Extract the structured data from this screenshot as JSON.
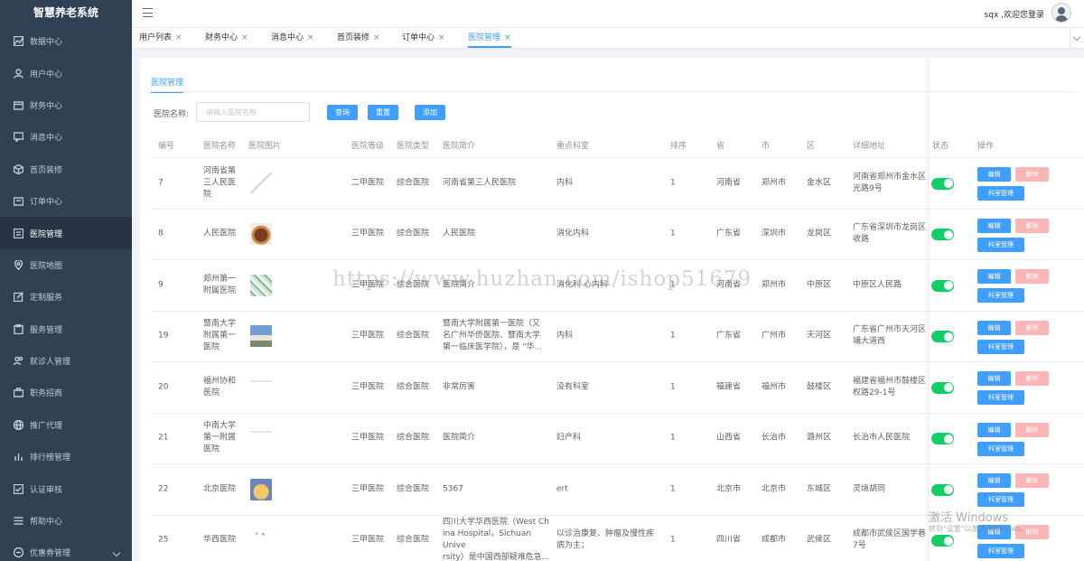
{
  "app": {
    "title": "智慧养老系统"
  },
  "sidebar": {
    "items": [
      {
        "label": "数据中心",
        "icon": "chart-icon"
      },
      {
        "label": "用户中心",
        "icon": "user-icon"
      },
      {
        "label": "财务中心",
        "icon": "wallet-icon"
      },
      {
        "label": "消息中心",
        "icon": "message-icon"
      },
      {
        "label": "首页装修",
        "icon": "cube-icon"
      },
      {
        "label": "订单中心",
        "icon": "cart-icon"
      },
      {
        "label": "医院管理",
        "icon": "list-icon",
        "active": true
      },
      {
        "label": "医院地图",
        "icon": "location-icon"
      },
      {
        "label": "定制服务",
        "icon": "edit-icon"
      },
      {
        "label": "服务管理",
        "icon": "clipboard-icon"
      },
      {
        "label": "就诊人管理",
        "icon": "users-icon"
      },
      {
        "label": "职务招商",
        "icon": "briefcase-icon"
      },
      {
        "label": "推广代理",
        "icon": "globe-icon"
      },
      {
        "label": "排行榜管理",
        "icon": "bars-icon"
      },
      {
        "label": "认证审核",
        "icon": "check-icon"
      },
      {
        "label": "帮助中心",
        "icon": "menu-icon"
      },
      {
        "label": "优惠券管理",
        "icon": "coupon-icon"
      }
    ]
  },
  "header": {
    "greeting": "sqx ,欢迎您登录"
  },
  "tabs": [
    {
      "label": "用户列表",
      "close": "×"
    },
    {
      "label": "财务中心",
      "close": "×"
    },
    {
      "label": "消息中心",
      "close": "×"
    },
    {
      "label": "首页装修",
      "close": "×"
    },
    {
      "label": "订单中心",
      "close": "×"
    },
    {
      "label": "医院管理",
      "close": "×",
      "active": true
    }
  ],
  "page": {
    "sub_tab": "医院管理",
    "search_label": "医院名称:",
    "search_placeholder": "请输入医院名称",
    "buttons": {
      "query": "查询",
      "reset": "重置",
      "add": "添加"
    }
  },
  "table": {
    "columns": [
      "编号",
      "医院名称",
      "医院图片",
      "医院等级",
      "医院类型",
      "医院简介",
      "重点科室",
      "排序",
      "省",
      "市",
      "区",
      "详细地址",
      "状态",
      "操作"
    ],
    "actions": {
      "edit": "编辑",
      "delete": "删除",
      "dept": "科室管理"
    },
    "rows": [
      {
        "id": "7",
        "name": [
          "河南省第",
          "三人民医",
          "院"
        ],
        "level": "二甲医院",
        "type": "综合医院",
        "intro": [
          "河南省第三人民医院"
        ],
        "dept": [
          "内科"
        ],
        "sort": "1",
        "province": "河南省",
        "city": "郑州市",
        "district": "金水区",
        "address": [
          "河南省郑州市金水区",
          "光路9号"
        ],
        "thumb": "line"
      },
      {
        "id": "8",
        "name": [
          "人民医院"
        ],
        "level": "三甲医院",
        "type": "综合医院",
        "intro": [
          "人民医院"
        ],
        "dept": [
          "消化内科"
        ],
        "sort": "1",
        "province": "广东省",
        "city": "深圳市",
        "district": "龙岗区",
        "address": [
          "广东省深圳市龙岗区",
          "收路"
        ],
        "thumb": "food"
      },
      {
        "id": "9",
        "name": [
          "郑州第一",
          "附属医院"
        ],
        "level": "三甲医院",
        "type": "综合医院",
        "intro": [
          "医院简介"
        ],
        "dept": [
          "消化科 心内科"
        ],
        "sort": "1",
        "province": "河南省",
        "city": "郑州市",
        "district": "中原区",
        "address": [
          "中原区人民路"
        ],
        "thumb": "plant"
      },
      {
        "id": "19",
        "name": [
          "暨南大学",
          "附属第一",
          "医院"
        ],
        "level": "三甲医院",
        "type": "综合医院",
        "intro": [
          "暨南大学附属第一医院（又",
          "名广州华侨医院、暨南大学",
          "第一临床医学院），是 \"华..."
        ],
        "dept": [
          "内科"
        ],
        "sort": "1",
        "province": "广东省",
        "city": "广州市",
        "district": "天河区",
        "address": [
          "广东省广州市天河区",
          "埔大道西"
        ],
        "thumb": "building"
      },
      {
        "id": "20",
        "name": [
          "福州协和",
          "医院"
        ],
        "level": "三甲医院",
        "type": "综合医院",
        "intro": [
          "非常厉害"
        ],
        "dept": [
          "没有科室"
        ],
        "sort": "1",
        "province": "福建省",
        "city": "福州市",
        "district": "鼓楼区",
        "address": [
          "福建省福州市鼓楼区",
          "权路29-1号"
        ],
        "thumb": "thin"
      },
      {
        "id": "21",
        "name": [
          "中南大学",
          "第一附属",
          "医院"
        ],
        "level": "三甲医院",
        "type": "综合医院",
        "intro": [
          "医院简介"
        ],
        "dept": [
          "妇产科"
        ],
        "sort": "1",
        "province": "山西省",
        "city": "长治市",
        "district": "潞州区",
        "address": [
          "长治市人民医院"
        ],
        "thumb": "thin"
      },
      {
        "id": "22",
        "name": [
          "北京医院"
        ],
        "level": "三甲医院",
        "type": "综合医院",
        "intro": [
          "5367"
        ],
        "dept": [
          "ert"
        ],
        "sort": "1",
        "province": "北京市",
        "city": "北京市",
        "district": "东城区",
        "address": [
          "灵境胡同"
        ],
        "thumb": "bear"
      },
      {
        "id": "25",
        "name": [
          "华西医院"
        ],
        "level": "三甲医院",
        "type": "综合医院",
        "intro": [
          "四川大学华西医院（West Ch",
          "ina Hospital，Sichuan Unive",
          "rsity）是中国西部疑难危急..."
        ],
        "dept": [
          "以诊治康复、肿瘤及慢性疾",
          "病为主；"
        ],
        "sort": "1",
        "province": "四川省",
        "city": "成都市",
        "district": "武侯区",
        "address": [
          "成都市武侯区国学巷",
          "7号"
        ],
        "thumb": "dots"
      }
    ]
  },
  "overlay": {
    "watermark": "https://www.huzhan.com/ishop51679",
    "windows_title": "激活 Windows",
    "windows_sub": "转到\"设置\"以激活 Windows。"
  }
}
